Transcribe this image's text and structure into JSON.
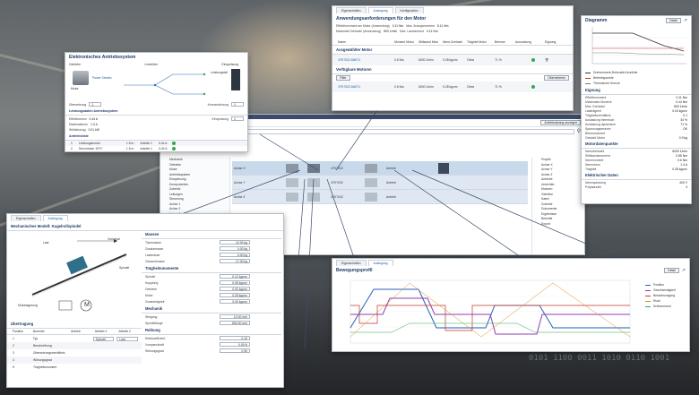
{
  "motor_window": {
    "tabs": [
      "Eigenschaften",
      "Auslegung",
      "Konfiguration"
    ],
    "active_tab": 1,
    "heading": "Anwendungsanforderungen für den Motor",
    "req_lines": [
      [
        "Effektivmoment am Motor (Anwendung)",
        "0.11 Nm",
        "Max. Anzugsmoment",
        "8.11 Nm"
      ],
      [
        "Maximale Drehzahl (Anwendung)",
        "800 1/min",
        "Max. Lastmoment",
        "0.11 Nm"
      ]
    ],
    "columns": [
      "Name",
      "Moment Motor",
      "Stillstand Motor",
      "Nenn-Drehzahl",
      "Trägheit Motor",
      "Bremse",
      "Ausnutzung",
      "Eignung"
    ],
    "selected_title": "Ausgewählter Motor",
    "selected_row": {
      "name": "1FK7022-5AK71",
      "c1": "0.6 Nm",
      "c2": "6000 1/min",
      "c3": "0.28 kgcm²",
      "c4": "Ohne",
      "c5": "71 %"
    },
    "available_title": "Verfügbare Motoren",
    "filter_label": "Filter",
    "apply_label": "Übernehmen",
    "available_row": {
      "name": "1FK7022-5AK71",
      "c1": "0.6 Nm",
      "c2": "6000 1/min",
      "c3": "0.28 kgcm²",
      "c4": "Ohne",
      "c5": "71 %"
    }
  },
  "diagram_window": {
    "title": "Diagramm",
    "button_label": "Detail",
    "legend": [
      "Drehmoment-Drehzahl-Kennlinie",
      "Betriebspunkte",
      "Thermische Grenze"
    ],
    "section_title": "Eignung",
    "props": [
      [
        "Effektivmoment",
        "0.11 Nm"
      ],
      [
        "Maximales Moment",
        "0.44 Nm"
      ],
      [
        "Max. Drehzahl",
        "800 1/min"
      ],
      [
        "Lastträgheit",
        "0.03 kgcm²"
      ],
      [
        "Trägheitsverhältnis",
        "0.1"
      ],
      [
        "Auslastung thermisch",
        "34 %"
      ],
      [
        "Auslastung dynamisch",
        "71 %"
      ],
      [
        "Spannungsreserve",
        "OK"
      ],
      [
        "Bremsmoment",
        "-"
      ],
      [
        "Gewicht Motor",
        "0.9 kg"
      ]
    ],
    "section2_title": "Motordatenpunkte",
    "props2": [
      [
        "Nenndrehzahl",
        "6000 1/min"
      ],
      [
        "Stillstandsmoment",
        "0.85 Nm"
      ],
      [
        "Nennmoment",
        "0.6 Nm"
      ],
      [
        "Nennstrom",
        "1.4 A"
      ],
      [
        "Trägheit",
        "0.28 kgcm²"
      ]
    ],
    "section3_title": "Elektrischer Daten",
    "props3": [
      [
        "Nennspannung",
        "400 V"
      ],
      [
        "Polpaarzahl",
        "3"
      ]
    ]
  },
  "drive_window": {
    "title": "Elektronisches Antriebssystem",
    "labels": [
      "Getriebe",
      "Motor",
      "Umrichter",
      "Leistungsteil",
      "Einspeisung"
    ],
    "motor_name": "Power Simotic",
    "gear_ratio_label": "Übersetzung",
    "gear_ratio_value": "1",
    "eff_title": "Leistungsdaten Antriebssystem",
    "eff_rows": [
      [
        "Effektivstrom",
        "0.44 A"
      ],
      [
        "Maximalstrom",
        "1.3 A"
      ],
      [
        "Wirkleistung",
        "0.01 kW"
      ]
    ],
    "extra_label": "Kennzeichnung",
    "extra_value": "1",
    "feed_label": "Einspeisung",
    "feed_value": "1",
    "table_title": "Antriebsliste",
    "table_cols": [
      "Bestell.",
      "Beschreibung",
      "Länge",
      "Achse",
      "Bezeichnung",
      "Max. Strom",
      "Eignung"
    ],
    "table_rows": [
      [
        "1",
        "Leistungsmodul",
        "1.5 m",
        "X",
        "Antrieb 1",
        "0.44 A"
      ],
      [
        "2",
        "Servomotor 1FK7",
        "1.5 m",
        "X",
        "Antrieb 1",
        "0.44 A"
      ]
    ]
  },
  "chain_window": {
    "search_placeholder": "Suchen",
    "expand_label": "Antriebsstrang anzeigen",
    "tree": [
      "Mechanik",
      "Getriebe",
      "Motor",
      "Antriebssystem",
      "Einspeisung",
      "Komponenten",
      "Zubehör",
      "Leitungen",
      "Steuerung",
      "Achse 1",
      "Achse 2",
      "Achse 3",
      "Projekt",
      "Bibliothek"
    ],
    "rows": [
      {
        "label": "Achse X",
        "info1": "1FK7022",
        "info2": "Antrieb"
      },
      {
        "label": "Achse Y",
        "info1": "1FK7032",
        "info2": "Antrieb"
      },
      {
        "label": "Achse Z",
        "info1": "1FK7042",
        "info2": "Antrieb"
      }
    ],
    "right_tree": [
      "Projekt",
      "Achse X",
      "Achse Y",
      "Achse Z",
      "Antriebe",
      "Umrichter",
      "Motoren",
      "Getriebe",
      "Kabel",
      "Zubehör",
      "Dokumente",
      "Ergebnisse",
      "Berichte",
      "Export"
    ]
  },
  "mech_window": {
    "tabs": [
      "Eigenschaften",
      "Auslegung"
    ],
    "title": "Mechanisches Modell: Kugelrollspindel",
    "fig_labels": [
      "Vorschub",
      "Last",
      "Spindel",
      "Motorlagerung",
      "M"
    ],
    "table_title": "Übertragung",
    "table_cols": [
      "Position",
      "Nummer",
      "Antrieb",
      "Abtrieb 1",
      "Abtrieb 2"
    ],
    "table_rows": [
      [
        "1",
        "Typ",
        "",
        "Spindel",
        "Last"
      ],
      [
        "2",
        "Beschreibung",
        "",
        "",
        ""
      ],
      [
        "3",
        "Übersetzungsverhältnis",
        "",
        "",
        ""
      ],
      [
        "4",
        "Wirkungsgrad",
        "",
        "",
        ""
      ],
      [
        "5",
        "Trägheitsmoment",
        "",
        "",
        ""
      ]
    ],
    "right_sections": [
      {
        "title": "Massen",
        "rows": [
          [
            "Tischmasse",
            "12.00 kg"
          ],
          [
            "Zusatzmasse",
            "0.00 kg"
          ],
          [
            "Lastmasse",
            "5.00 kg"
          ],
          [
            "Gesamtmasse",
            "17.00 kg"
          ]
        ]
      },
      {
        "title": "Trägheitsmomente",
        "rows": [
          [
            "Spindel",
            "0.12 kgcm²"
          ],
          [
            "Kupplung",
            "0.05 kgcm²"
          ],
          [
            "Getriebe",
            "0.00 kgcm²"
          ],
          [
            "Motor",
            "0.28 kgcm²"
          ],
          [
            "Zusatzträgheit",
            "0.00 kgcm²"
          ]
        ]
      },
      {
        "title": "Mechanik",
        "rows": [
          [
            "Steigung",
            "10.00 mm"
          ],
          [
            "Spindellänge",
            "800.00 mm"
          ]
        ]
      },
      {
        "title": "Reibung",
        "rows": [
          [
            "Reibkoeffizient",
            "0.10"
          ],
          [
            "Vorspannkraft",
            "0.00 N"
          ],
          [
            "Wirkungsgrad",
            "0.90"
          ]
        ]
      }
    ]
  },
  "motion_window": {
    "tabs": [
      "Eigenschaften",
      "Auslegung"
    ],
    "title": "Bewegungsprofil",
    "button_label": "Detail",
    "legend": [
      "Position",
      "Geschwindigkeit",
      "Beschleunigung",
      "Ruck",
      "Drehmoment"
    ]
  },
  "binary_text": "0101  1100  0011  1010  0110  1001",
  "colors": {
    "accent": "#1a5aa0",
    "ok": "#2fa84f",
    "row_blue": "#c9d9ec"
  },
  "icons": [
    "search-icon",
    "motor-icon",
    "drive-icon",
    "gear-icon",
    "close-icon",
    "expand-icon"
  ]
}
